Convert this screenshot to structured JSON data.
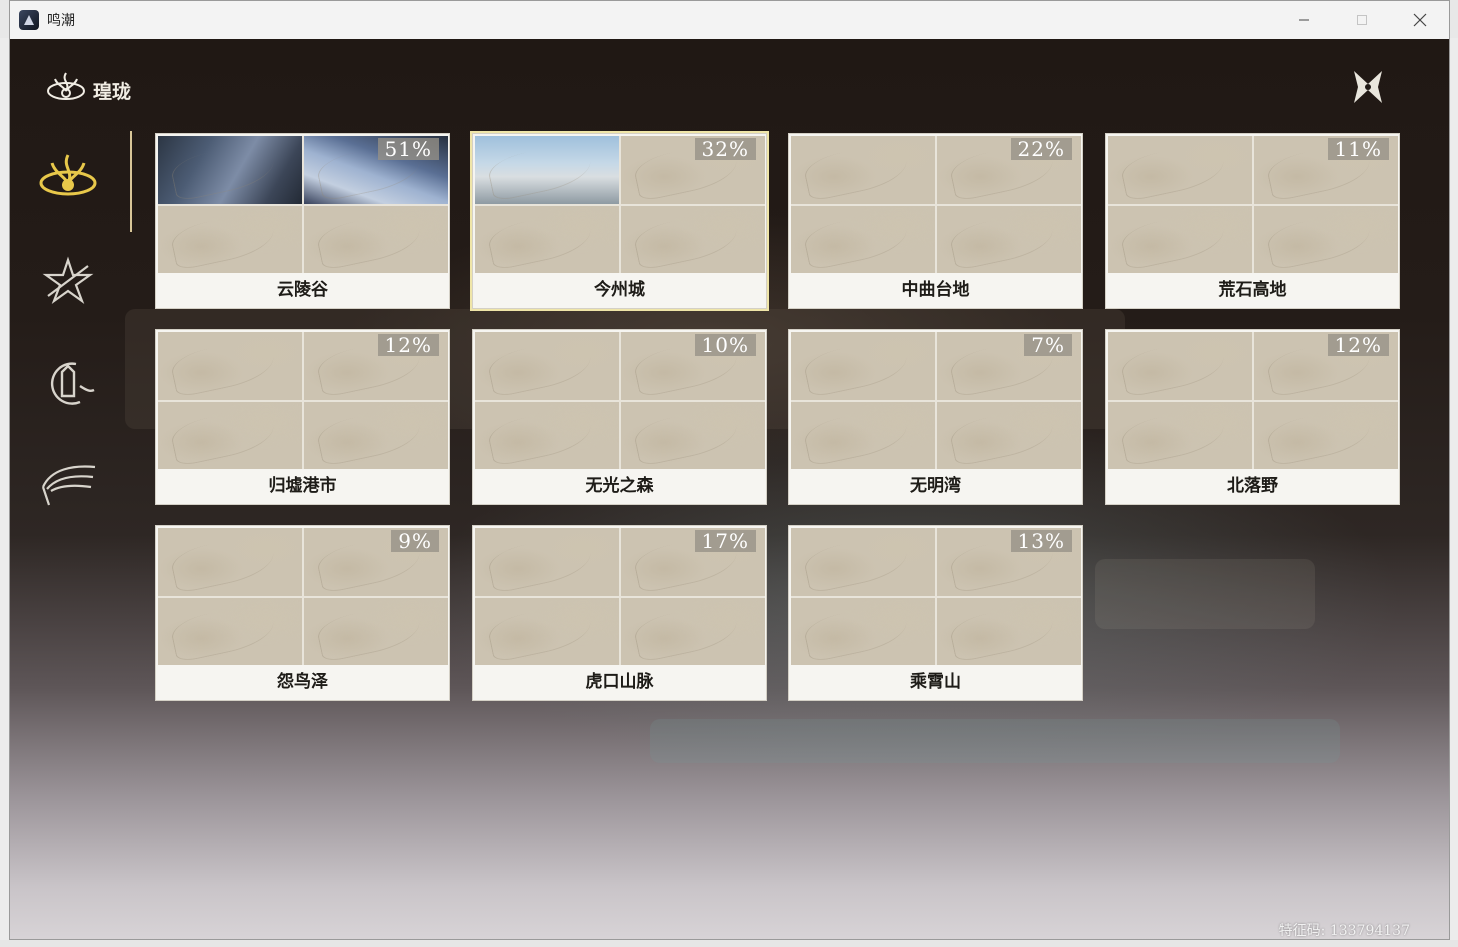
{
  "window": {
    "title": "鸣潮",
    "minimize_icon": "minimize-icon",
    "maximize_icon": "maximize-icon",
    "close_icon": "close-icon"
  },
  "header": {
    "brand_label": "瑝珑",
    "brand_icon": "dragon-emblem-icon",
    "close_icon": "close-x-icon"
  },
  "sidebar": {
    "items": [
      {
        "icon": "jinzhou-emblem-icon",
        "selected": true
      },
      {
        "icon": "star-emblem-icon",
        "selected": false
      },
      {
        "icon": "moon-emblem-icon",
        "selected": false
      },
      {
        "icon": "wing-emblem-icon",
        "selected": false
      }
    ]
  },
  "regions": [
    {
      "name": "云陵谷",
      "percent": "51%",
      "selected": false
    },
    {
      "name": "今州城",
      "percent": "32%",
      "selected": true
    },
    {
      "name": "中曲台地",
      "percent": "22%",
      "selected": false
    },
    {
      "name": "荒石高地",
      "percent": "11%",
      "selected": false
    },
    {
      "name": "归墟港市",
      "percent": "12%",
      "selected": false
    },
    {
      "name": "无光之森",
      "percent": "10%",
      "selected": false
    },
    {
      "name": "无明湾",
      "percent": "7%",
      "selected": false
    },
    {
      "name": "北落野",
      "percent": "12%",
      "selected": false
    },
    {
      "name": "怨鸟泽",
      "percent": "9%",
      "selected": false
    },
    {
      "name": "虎口山脉",
      "percent": "17%",
      "selected": false
    },
    {
      "name": "乘霄山",
      "percent": "13%",
      "selected": false
    }
  ],
  "footer": {
    "uid_text": "特征码: 133794137"
  },
  "colors": {
    "accent_gold": "#d8c698",
    "selected_outline": "#efe5a8",
    "card_bg": "#f6f5f1",
    "badge_bg": "#969187"
  }
}
